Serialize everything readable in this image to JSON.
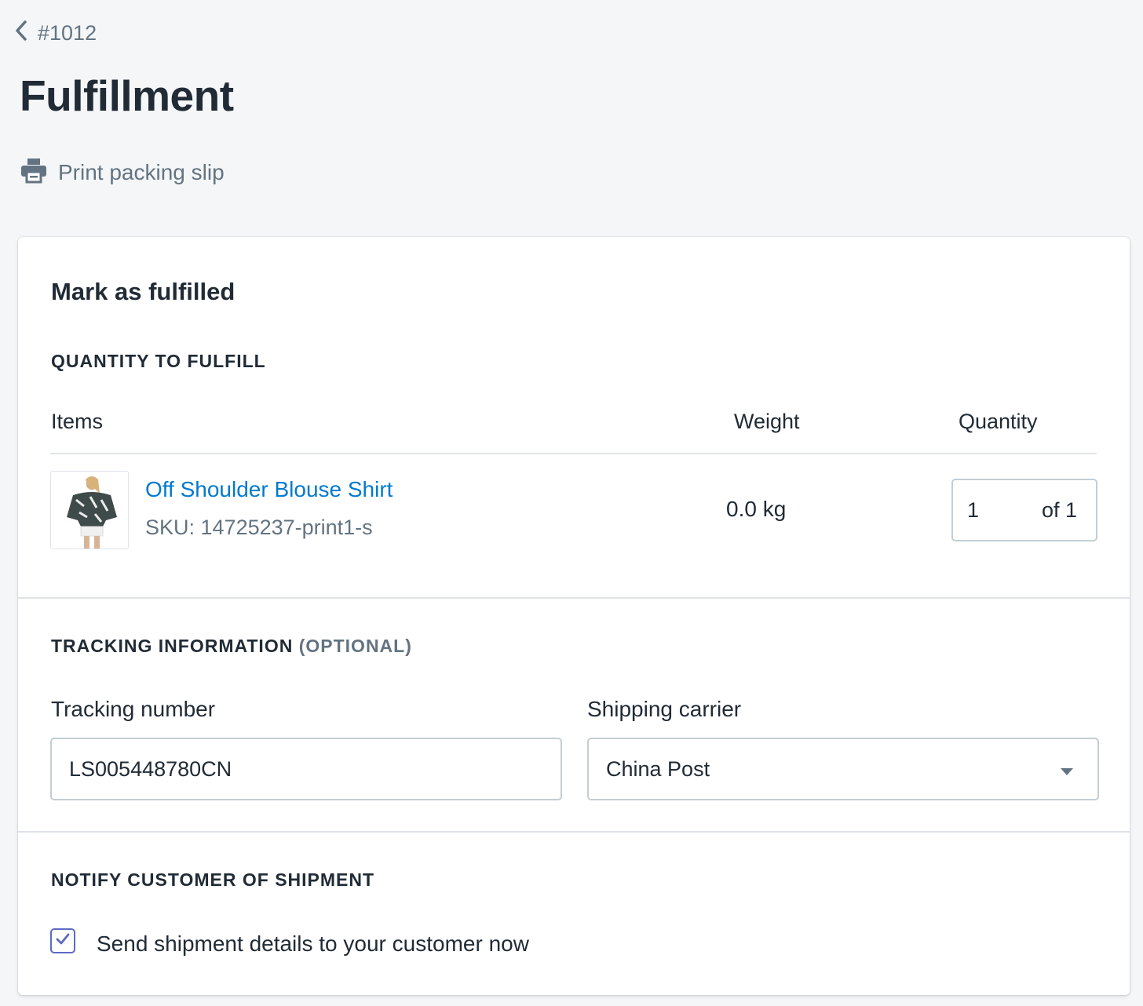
{
  "breadcrumb": {
    "label": "#1012"
  },
  "page": {
    "title": "Fulfillment"
  },
  "actions": {
    "print_label": "Print packing slip"
  },
  "card": {
    "title": "Mark as fulfilled",
    "quantity_section": {
      "heading": "QUANTITY TO FULFILL",
      "columns": {
        "items": "Items",
        "weight": "Weight",
        "quantity": "Quantity"
      },
      "items": [
        {
          "name": "Off Shoulder Blouse Shirt",
          "sku": "SKU: 14725237-print1-s",
          "weight": "0.0 kg",
          "quantity_value": "1",
          "quantity_total": "of 1"
        }
      ]
    },
    "tracking_section": {
      "heading": "TRACKING INFORMATION",
      "heading_optional": "(OPTIONAL)",
      "tracking_label": "Tracking number",
      "tracking_value": "LS005448780CN",
      "carrier_label": "Shipping carrier",
      "carrier_value": "China Post"
    },
    "notify_section": {
      "heading": "NOTIFY CUSTOMER OF SHIPMENT",
      "checkbox_label": "Send shipment details to your customer now",
      "checked": true
    }
  },
  "colors": {
    "link": "#007ace",
    "checkbox_accent": "#5c6ac4",
    "background": "#f4f6f8",
    "text_subdued": "#637381"
  },
  "icons": {
    "back": "chevron-left-icon",
    "print": "printer-icon",
    "dropdown": "caret-down-icon",
    "check": "checkmark-icon"
  }
}
